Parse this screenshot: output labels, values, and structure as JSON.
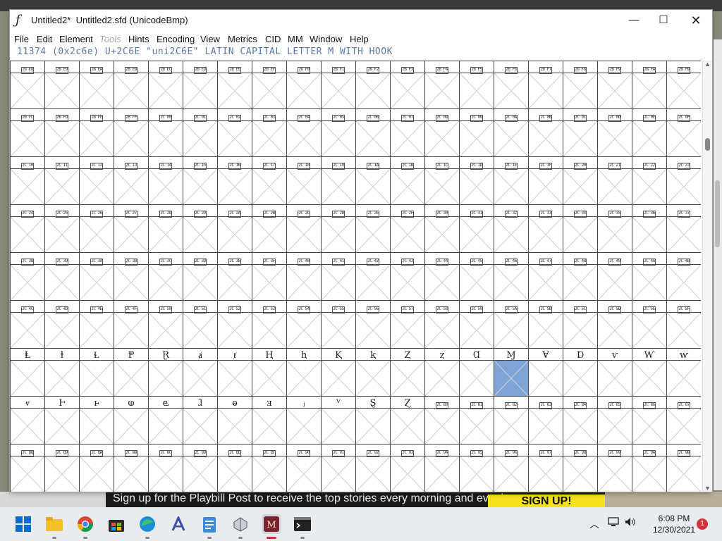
{
  "window": {
    "title": "Untitled2*  Untitled2.sfd (UnicodeBmp)",
    "app_icon": "fontforge-icon",
    "controls": {
      "minimize": "—",
      "maximize": "☐",
      "close": "✕"
    }
  },
  "menu": [
    "File",
    "Edit",
    "Element",
    "Tools",
    "Hints",
    "Encoding",
    "View",
    "Metrics",
    "CID",
    "MM",
    "Window",
    "Help"
  ],
  "menu_disabled": [
    "Tools"
  ],
  "info": "11374 (0x2c6e) U+2C6E \"uni2C6E\" LATIN CAPITAL LETTER M WITH HOOK",
  "grid": {
    "rows": [
      [
        "2B E8",
        "2B E9",
        "2B EA",
        "2B EB",
        "2B EC",
        "2B ED",
        "2B EE",
        "2B EF",
        "2B F0",
        "2B F1",
        "2B F2",
        "2B F3",
        "2B F4",
        "2B F5",
        "2B F6",
        "2B F7",
        "2B F8",
        "2B F9",
        "2B FA",
        "2B FB"
      ],
      [
        "2B FC",
        "2B FD",
        "2B FE",
        "2B FF",
        "2C 00",
        "2C 01",
        "2C 02",
        "2C 03",
        "2C 04",
        "2C 05",
        "2C 06",
        "2C 07",
        "2C 08",
        "2C 09",
        "2C 0A",
        "2C 0B",
        "2C 0C",
        "2C 0D",
        "2C 0E",
        "2C 0F"
      ],
      [
        "2C 10",
        "2C 11",
        "2C 12",
        "2C 13",
        "2C 14",
        "2C 15",
        "2C 16",
        "2C 17",
        "2C 18",
        "2C 19",
        "2C 1A",
        "2C 1B",
        "2C 1C",
        "2C 1D",
        "2C 1E",
        "2C 1F",
        "2C 20",
        "2C 21",
        "2C 22",
        "2C 23"
      ],
      [
        "2C 24",
        "2C 25",
        "2C 26",
        "2C 27",
        "2C 28",
        "2C 29",
        "2C 2A",
        "2C 2B",
        "2C 2C",
        "2C 2D",
        "2C 2E",
        "2C 2F",
        "2C 30",
        "2C 31",
        "2C 32",
        "2C 33",
        "2C 34",
        "2C 35",
        "2C 36",
        "2C 37"
      ],
      [
        "2C 38",
        "2C 39",
        "2C 3A",
        "2C 3B",
        "2C 3C",
        "2C 3D",
        "2C 3E",
        "2C 3F",
        "2C 40",
        "2C 41",
        "2C 42",
        "2C 43",
        "2C 44",
        "2C 45",
        "2C 46",
        "2C 47",
        "2C 48",
        "2C 49",
        "2C 4A",
        "2C 4B"
      ],
      [
        "2C 4C",
        "2C 4D",
        "2C 4E",
        "2C 4F",
        "2C 50",
        "2C 51",
        "2C 52",
        "2C 53",
        "2C 54",
        "2C 55",
        "2C 56",
        "2C 57",
        "2C 58",
        "2C 59",
        "2C 5A",
        "2C 5B",
        "2C 5C",
        "2C 5D",
        "2C 5E",
        "2C 5F"
      ],
      [
        "Ⱡ",
        "ⱡ",
        "Ɫ",
        "Ᵽ",
        "Ɽ",
        "ⱥ",
        "ⱦ",
        "Ⱨ",
        "ⱨ",
        "Ⱪ",
        "ⱪ",
        "Ⱬ",
        "ⱬ",
        "Ɑ",
        "Ɱ",
        "Ɐ",
        "Ɒ",
        "ⱱ",
        "Ⱳ",
        "ⱳ"
      ],
      [
        "ⱴ",
        "Ⱶ",
        "ⱶ",
        "ⱷ",
        "ⱸ",
        "ⱹ",
        "ⱺ",
        "ⱻ",
        "ⱼ",
        "ⱽ",
        "Ȿ",
        "Ɀ",
        "2C 80",
        "2C 81",
        "2C 82",
        "2C 83",
        "2C 84",
        "2C 85",
        "2C 86",
        "2C 87"
      ],
      [
        "2C 88",
        "2C 89",
        "2C 8A",
        "2C 8B",
        "2C 8C",
        "2C 8D",
        "2C 8E",
        "2C 8F",
        "2C 90",
        "2C 91",
        "2C 92",
        "2C 93",
        "2C 94",
        "2C 95",
        "2C 96",
        "2C 97",
        "2C 98",
        "2C 99",
        "2C 9A",
        "2C 9B"
      ]
    ],
    "selected": {
      "row": 6,
      "col": 14
    }
  },
  "background": {
    "banner_text": "Sign up for the Playbill Post to receive the top stories every morning and evening.",
    "banner_button": "SIGN UP!"
  },
  "taskbar": {
    "icons": [
      "start-icon",
      "file-explorer-icon",
      "chrome-icon",
      "store-icon",
      "edge-icon",
      "font-app-icon",
      "notepad-icon",
      "app-icon",
      "fontforge-taskbar-icon",
      "terminal-icon"
    ],
    "time": "6:08 PM",
    "date": "12/30/2021",
    "notifications": "1"
  }
}
